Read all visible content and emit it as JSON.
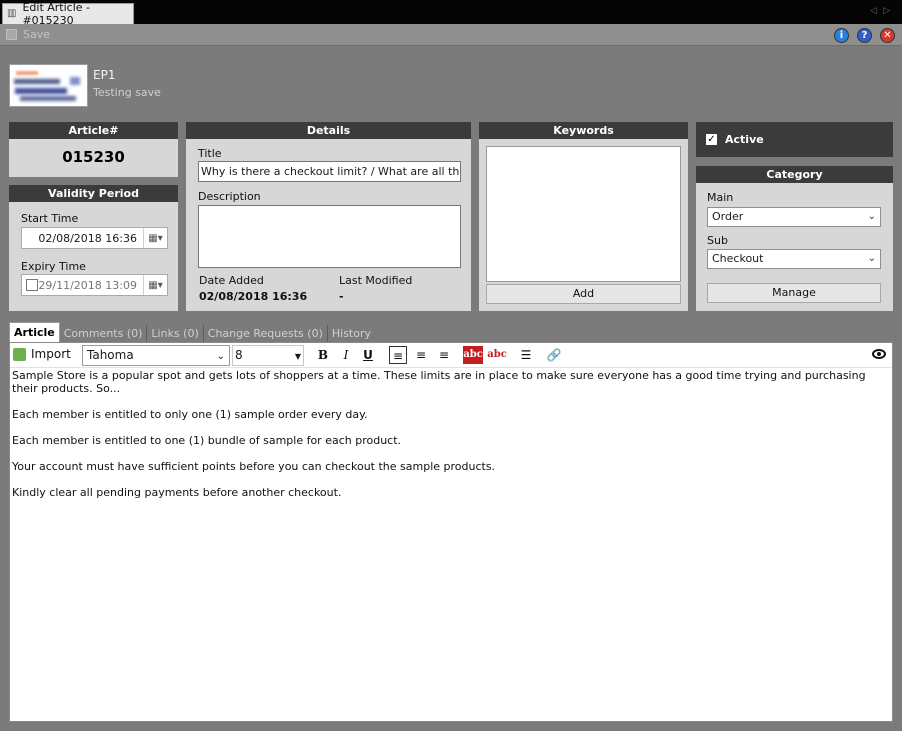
{
  "window": {
    "tab_title": "Edit Article - #015230"
  },
  "toolbar": {
    "save_label": "Save"
  },
  "header": {
    "name": "EP1",
    "subtitle": "Testing save"
  },
  "article_panel": {
    "heading": "Article#",
    "number": "015230"
  },
  "validity": {
    "heading": "Validity Period",
    "start_label": "Start Time",
    "start_value": "02/08/2018 16:36",
    "expiry_label": "Expiry Time",
    "expiry_value": "29/11/2018 13:09"
  },
  "details": {
    "heading": "Details",
    "title_label": "Title",
    "title_value": "Why is there a checkout limit? / What are all the ch",
    "description_label": "Description",
    "description_value": "",
    "date_added_label": "Date Added",
    "date_added_value": "02/08/2018 16:36",
    "last_modified_label": "Last Modified",
    "last_modified_value": "-"
  },
  "keywords": {
    "heading": "Keywords",
    "add_label": "Add"
  },
  "active": {
    "label": "Active",
    "checked": true
  },
  "category": {
    "heading": "Category",
    "main_label": "Main",
    "main_value": "Order",
    "sub_label": "Sub",
    "sub_value": "Checkout",
    "manage_label": "Manage"
  },
  "tabs": [
    {
      "label": "Article"
    },
    {
      "label": "Comments (0)"
    },
    {
      "label": "Links (0)"
    },
    {
      "label": "Change Requests (0)"
    },
    {
      "label": "History"
    }
  ],
  "editor": {
    "import_label": "Import",
    "font": "Tahoma",
    "size": "8",
    "bold": "B",
    "italic": "I",
    "underline": "U",
    "spell_a": "abc",
    "spell_b": "abc",
    "paragraphs": [
      "Sample Store is a popular spot and gets lots of shoppers at a time. These limits are in place to make sure everyone has a good time trying and purchasing their products. So...",
      "Each member is entitled to only one (1) sample order every day.",
      "Each member is entitled to one (1) bundle of sample for each product.",
      "Your account must have sufficient points before you can checkout the sample products.",
      "Kindly clear all pending payments before another checkout."
    ]
  }
}
